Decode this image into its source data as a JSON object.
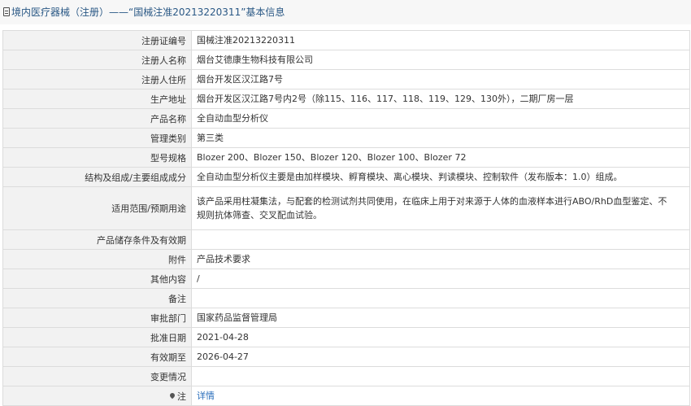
{
  "header": {
    "title": "境内医疗器械（注册）——“国械注准20213220311”基本信息"
  },
  "rows": [
    {
      "label": "注册证编号",
      "value": "国械注准20213220311"
    },
    {
      "label": "注册人名称",
      "value": "烟台艾德康生物科技有限公司"
    },
    {
      "label": "注册人住所",
      "value": "烟台开发区汉江路7号"
    },
    {
      "label": "生产地址",
      "value": "烟台开发区汉江路7号内2号（除115、116、117、118、119、129、130外），二期厂房一层"
    },
    {
      "label": "产品名称",
      "value": "全自动血型分析仪"
    },
    {
      "label": "管理类别",
      "value": "第三类"
    },
    {
      "label": "型号规格",
      "value": "Blozer 200、Blozer 150、Blozer 120、Blozer 100、Blozer 72"
    },
    {
      "label": "结构及组成/主要组成成分",
      "value": "全自动血型分析仪主要是由加样模块、孵育模块、离心模块、判读模块、控制软件（发布版本：1.0）组成。"
    },
    {
      "label": "适用范围/预期用途",
      "value": "该产品采用柱凝集法，与配套的检测试剂共同使用，在临床上用于对来源于人体的血液样本进行ABO/RhD血型鉴定、不规则抗体筛查、交叉配血试验。"
    },
    {
      "label": "产品储存条件及有效期",
      "value": ""
    },
    {
      "label": "附件",
      "value": "产品技术要求"
    },
    {
      "label": "其他内容",
      "value": "/"
    },
    {
      "label": "备注",
      "value": ""
    },
    {
      "label": "审批部门",
      "value": "国家药品监督管理局"
    },
    {
      "label": "批准日期",
      "value": "2021-04-28"
    },
    {
      "label": "有效期至",
      "value": "2026-04-27"
    },
    {
      "label": "变更情况",
      "value": ""
    }
  ],
  "note_row": {
    "label": "注",
    "link_text": "详情",
    "icon": "pin-icon"
  }
}
